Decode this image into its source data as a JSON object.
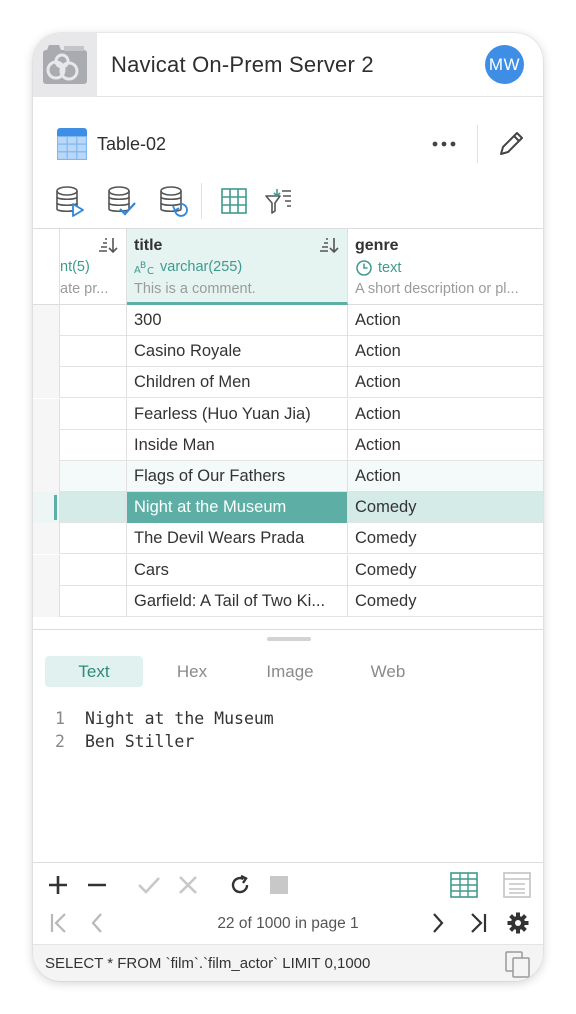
{
  "header": {
    "title": "Navicat On-Prem Server 2",
    "avatar_initials": "MW"
  },
  "table": {
    "name": "Table-02"
  },
  "grid": {
    "columns": [
      {
        "name": "",
        "type": "",
        "comment": ""
      },
      {
        "name": "",
        "type": "nt(5)",
        "comment": "ate pr..."
      },
      {
        "name": "title",
        "type": "varchar(255)",
        "comment": "This is a comment."
      },
      {
        "name": "genre",
        "type": "text",
        "comment": "A short description or pl..."
      }
    ],
    "rows": [
      {
        "title": "300",
        "genre": "Action"
      },
      {
        "title": "Casino Royale",
        "genre": "Action"
      },
      {
        "title": "Children of Men",
        "genre": "Action"
      },
      {
        "title": "Fearless (Huo Yuan Jia)",
        "genre": "Action"
      },
      {
        "title": "Inside Man",
        "genre": "Action"
      },
      {
        "title": "Flags of Our Fathers",
        "genre": "Action"
      },
      {
        "title": "Night at the Museum",
        "genre": "Comedy"
      },
      {
        "title": "The Devil Wears Prada",
        "genre": "Comedy"
      },
      {
        "title": "Cars",
        "genre": "Comedy"
      },
      {
        "title": "Garfield: A Tail of Two Ki...",
        "genre": "Comedy"
      }
    ],
    "selected_row": 6,
    "hover_row": 5
  },
  "viewer": {
    "tabs": [
      "Text",
      "Hex",
      "Image",
      "Web"
    ],
    "active_tab": "Text",
    "lines": [
      {
        "n": "1",
        "text": "Night at the Museum"
      },
      {
        "n": "2",
        "text": "Ben Stiller"
      }
    ]
  },
  "pager": {
    "info": "22 of 1000 in page 1"
  },
  "sql": {
    "text": "SELECT * FROM `film`.`film_actor` LIMIT 0,1000"
  },
  "colors": {
    "accent": "#5dafa6",
    "accent_light": "#e5f3f1",
    "avatar": "#3f8ee6",
    "table_icon": "#3f8ee6"
  }
}
